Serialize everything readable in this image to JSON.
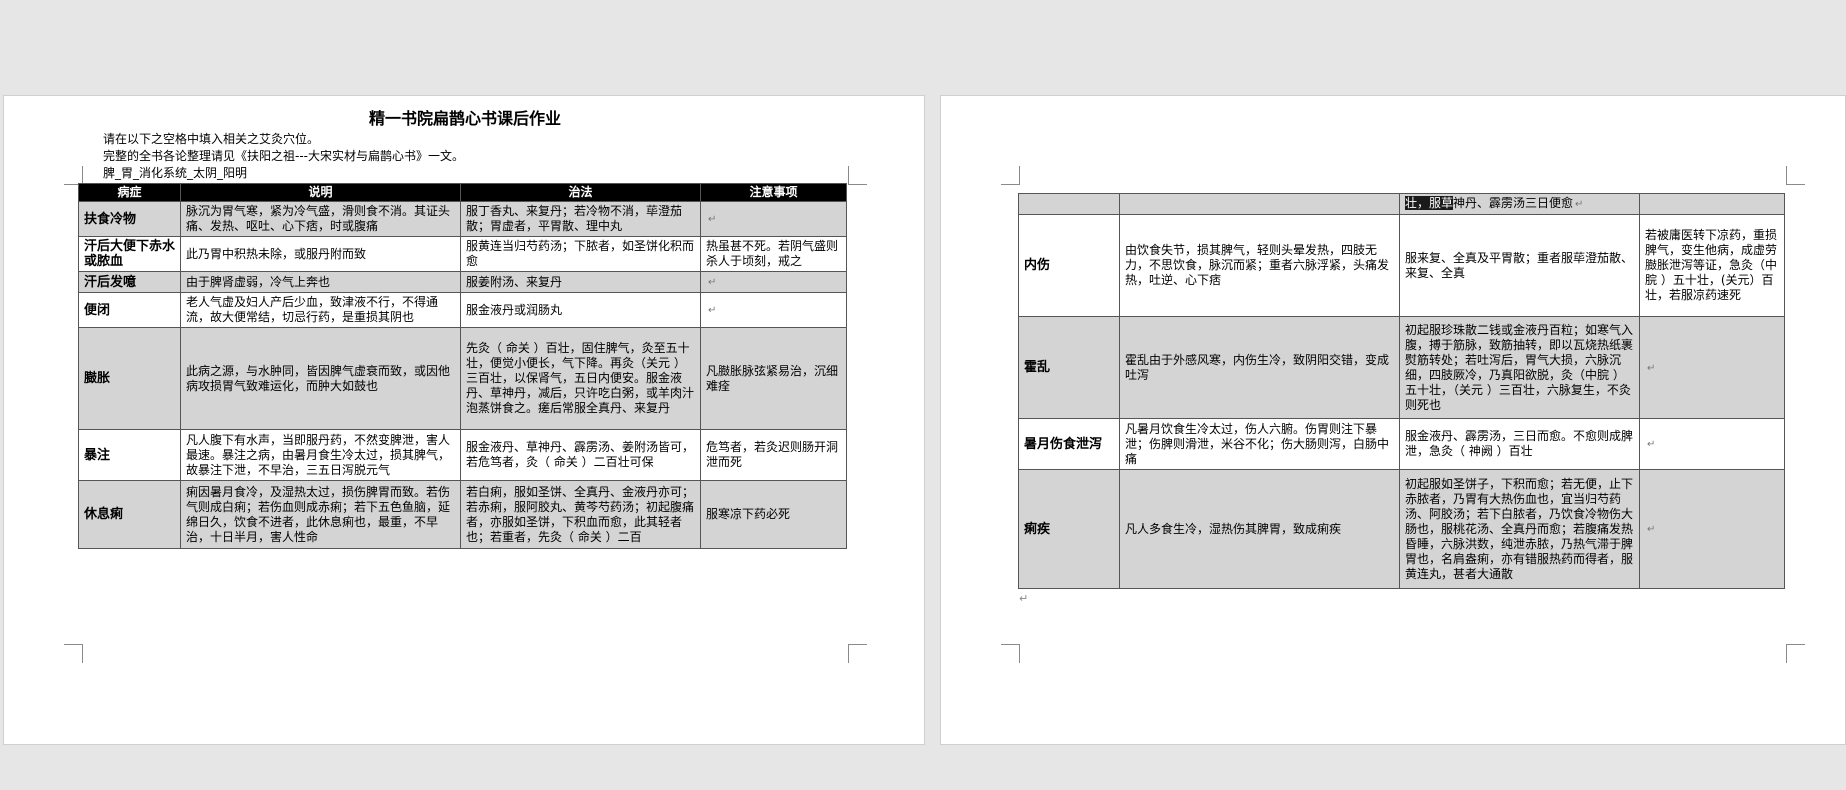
{
  "document": {
    "title": "精一书院扁鹊心书课后作业",
    "intro": [
      "请在以下之空格中填入相关之艾灸穴位。",
      "完整的全书各论整理请见《扶阳之祖---大宋实材与扁鹊心书》一文。",
      "脾_胃_消化系统_太阴_阳明"
    ],
    "para_mark": "↵",
    "columns": [
      "病症",
      "说明",
      "治法",
      "注意事项"
    ],
    "left_rows": [
      {
        "name": "扶食冷物",
        "desc": "脉沉为胃气寒，紧为冷气盛，滑则食不消。其证头痛、发热、呕吐、心下痞，时或腹痛",
        "treat": "服丁香丸、来复丹；若冷物不消，荜澄茄散；胃虚者，平胃散、理中丸",
        "note": ""
      },
      {
        "name": "汗后大便下赤水或脓血",
        "desc": "此乃胃中积热未除，或服丹附而致",
        "treat": "服黄连当归芍药汤；下脓者，如圣饼化积而愈",
        "note": "热虽甚不死。若阴气盛则杀人于顷刻，戒之"
      },
      {
        "name": "汗后发噫",
        "desc": "由于脾肾虚弱，冷气上奔也",
        "treat": "服姜附汤、来复丹",
        "note": ""
      },
      {
        "name": "便闭",
        "desc": "老人气虚及妇人产后少血，致津液不行，不得通流，故大便常结，切忌行药，是重损其阴也",
        "treat": "服金液丹或润肠丸",
        "note": ""
      },
      {
        "name": "臌胀",
        "desc": "此病之源，与水肿同，皆因脾气虚衰而致，或因他病攻损胃气致难运化，而肿大如鼓也",
        "treat": "先灸（ 命关 ）百壮，固住脾气，灸至五十壮，便觉小便长，气下降。再灸（关元 ）三百壮，以保肾气，五日内便安。服金液丹、草神丹，减后，只许吃白粥，或羊肉汁泡蒸饼食之。瘥后常服全真丹、来复丹",
        "note": "凡臌胀脉弦紧易治，沉细难痊"
      },
      {
        "name": "暴注",
        "desc": "凡人腹下有水声，当即服丹药，不然变脾泄，害人最速。暴注之病，由暑月食生冷太过，损其脾气，故暴注下泄，不早治，三五日泻脱元气",
        "treat": "服金液丹、草神丹、霹雳汤、姜附汤皆可，若危笃者，灸（ 命关 ）二百壮可保",
        "note": "危笃者，若灸迟则肠开洞泄而死"
      },
      {
        "name": "休息痢",
        "desc": "痢因暑月食冷，及湿热太过，损伤脾胃而致。若伤气则成白痢；若伤血则成赤痢；若下五色鱼脑，延绵日久，饮食不进者，此休息痢也，最重，不早治，十日半月，害人性命",
        "treat": "若白痢，服如圣饼、全真丹、金液丹亦可；若赤痢，服阿胶丸、黄芩芍药汤；初起腹痛者，亦服如圣饼，下积血而愈，此其轻者也；若重者，先灸（ 命关 ）二百",
        "note": "服寒凉下药必死"
      }
    ],
    "right_continuation": {
      "treat_lead": "壮，服草",
      "treat_rest": "神丹、霹雳汤三日便愈"
    },
    "right_rows": [
      {
        "name": "内伤",
        "desc": "由饮食失节，损其脾气，轻则头晕发热，四肢无力，不思饮食，脉沉而紧；重者六脉浮紧，头痛发热，吐逆、心下痞",
        "treat": "服来复、全真及平胃散；重者服荜澄茄散、来复、全真",
        "note": "若被庸医转下凉药，重损脾气，变生他病，成虚劳臌胀泄泻等证，急灸（中脘 ）五十壮，(关元）百壮，若服凉药速死"
      },
      {
        "name": "霍乱",
        "desc": "霍乱由于外感风寒，内伤生冷，致阴阳交错，变成吐泻",
        "treat": "初起服珍珠散二钱或金液丹百粒；如寒气入腹，搏于筋脉，致筋抽转，即以瓦烧热纸裹熨筋转处；若吐泻后，胃气大损，六脉沉细，四肢厥冷，乃真阳欲脱，灸（中脘 ）五十壮，（关元 ）三百壮，六脉复生，不灸则死也",
        "note": ""
      },
      {
        "name": "暑月伤食泄泻",
        "desc": "凡暑月饮食生冷太过，伤人六腑。伤胃则注下暴泄；伤脾则滑泄，米谷不化；伤大肠则泻，白肠中痛",
        "treat": "服金液丹、霹雳汤，三日而愈。不愈则成脾泄，急灸（ 神阙 ）百壮",
        "note": ""
      },
      {
        "name": "痢疾",
        "desc": "凡人多食生冷，湿热伤其脾胃，致成痢疾",
        "treat": "初起服如圣饼子，下积而愈；若无便，止下赤脓者，乃胃有大热伤血也，宜当归芍药汤、阿胶汤；若下白脓者，乃饮食冷物伤大肠也，服桃花汤、全真丹而愈；若腹痛发热昏睡，六脉洪数，纯泄赤脓，乃热气滞于脾胃也，名肩盎痢，亦有错服热药而得者，服黄连丸，甚者大通散",
        "note": ""
      }
    ]
  }
}
